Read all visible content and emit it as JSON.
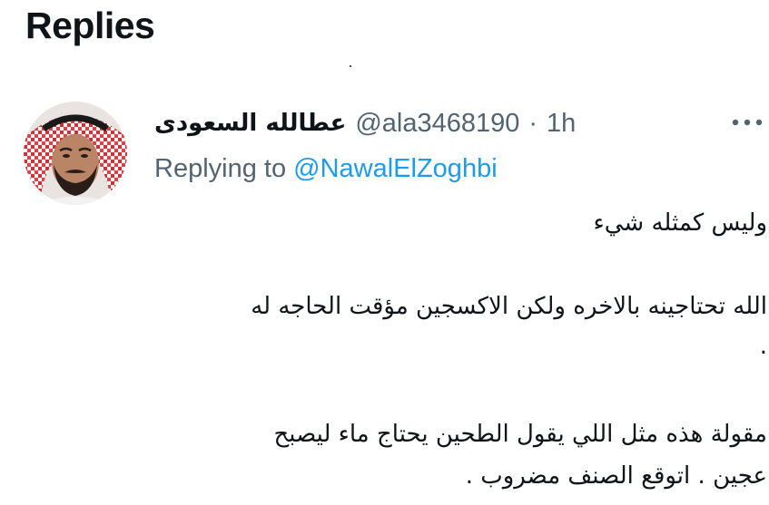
{
  "section": {
    "title": "Replies"
  },
  "tweet": {
    "display_name": "عطالله السعودى",
    "handle": "@ala3468190",
    "separator": "·",
    "time": "1h",
    "replying_prefix": "Replying to",
    "replying_to": "@NawalElZoghbi",
    "body_lines": [
      "وليس كمثله شيء",
      "الله تحتاجينه بالاخره ولكن الاكسجين مؤقت الحاجه له",
      ".",
      "مقولة  هذه مثل اللي يقول الطحين يحتاج ماء ليصبح",
      "عجين . اتوقع الصنف مضروب ."
    ]
  },
  "icons": {
    "more": "more-horizontal-icon",
    "avatar": "profile-avatar"
  },
  "colors": {
    "text": "#0f1419",
    "muted": "#536471",
    "link": "#1d9bf0",
    "background": "#ffffff"
  }
}
